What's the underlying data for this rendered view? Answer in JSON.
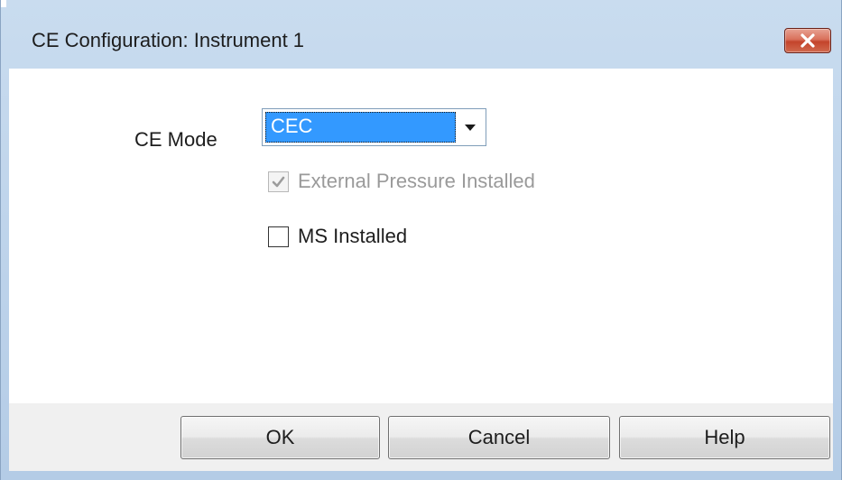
{
  "window": {
    "title": "CE Configuration: Instrument 1",
    "close_icon": "close-icon"
  },
  "form": {
    "ce_mode_label": "CE Mode",
    "ce_mode_value": "CEC",
    "ce_mode_dropdown_icon": "chevron-down-icon",
    "external_pressure": {
      "label": "External Pressure Installed",
      "checked": true,
      "enabled": false
    },
    "ms_installed": {
      "label": "MS Installed",
      "checked": false,
      "enabled": true
    }
  },
  "buttons": {
    "ok": "OK",
    "cancel": "Cancel",
    "help": "Help"
  },
  "colors": {
    "selection": "#3399ff",
    "close_button": "#c4442b",
    "title_bar": "#c9dcef",
    "footer": "#f0f0f0"
  }
}
